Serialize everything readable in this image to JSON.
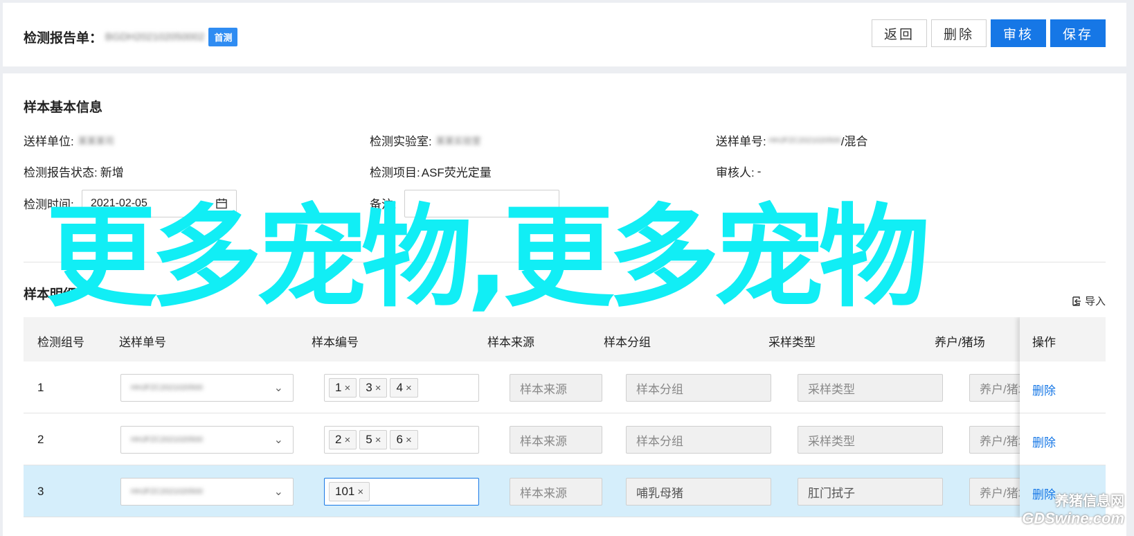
{
  "header": {
    "title": "检测报告单：",
    "report_id": "BGDH202102050002",
    "badge": "首测",
    "buttons": {
      "back": "返回",
      "delete": "删除",
      "review": "审核",
      "save": "保存"
    }
  },
  "basic_info": {
    "section_title": "样本基本信息",
    "sender_unit": {
      "label": "送样单位:",
      "value": "某某某司"
    },
    "lab": {
      "label": "检测实验室:",
      "value": "某某实验室"
    },
    "sample_order": {
      "label": "送样单号:",
      "value": "HHJFZC2021020500",
      "suffix": "/混合"
    },
    "report_status": {
      "label": "检测报告状态:",
      "value": "新增"
    },
    "test_item": {
      "label": "检测项目:",
      "value": "ASF荧光定量"
    },
    "reviewer": {
      "label": "审核人:",
      "value": "-"
    },
    "test_time": {
      "label": "检测时间:",
      "value": "2021-02-05"
    },
    "remark": {
      "label": "备注:",
      "value": ""
    }
  },
  "detail": {
    "section_title": "样本明细",
    "import_label": "导入",
    "columns": [
      "检测组号",
      "送样单号",
      "样本编号",
      "样本来源",
      "样本分组",
      "采样类型",
      "养户/猪场"
    ],
    "op_header": "操作",
    "rows": [
      {
        "num": "1",
        "order": "HHJFZC2021020500",
        "tags": [
          "1",
          "3",
          "4"
        ],
        "source": "样本来源",
        "group": "样本分组",
        "type": "采样类型",
        "farm": "养户/猪场",
        "op": "删除"
      },
      {
        "num": "2",
        "order": "HHJFZC2021020500",
        "tags": [
          "2",
          "5",
          "6"
        ],
        "source": "样本来源",
        "group": "样本分组",
        "type": "采样类型",
        "farm": "养户/猪场",
        "op": "删除"
      },
      {
        "num": "3",
        "order": "HHJFZC2021020500",
        "tags": [
          "101"
        ],
        "source": "样本来源",
        "group": "哺乳母猪",
        "type": "肛门拭子",
        "farm": "养户/猪场",
        "op": "删除"
      }
    ]
  },
  "watermark": {
    "text": "更多宠物,更多宠物",
    "corner_line1": "养猪信息网",
    "corner_line2": "GDSwine.com"
  },
  "colors": {
    "primary": "#1677e6",
    "badge": "#2f8cf2",
    "highlight_row": "#d5eefb",
    "watermark": "#11eef5"
  }
}
